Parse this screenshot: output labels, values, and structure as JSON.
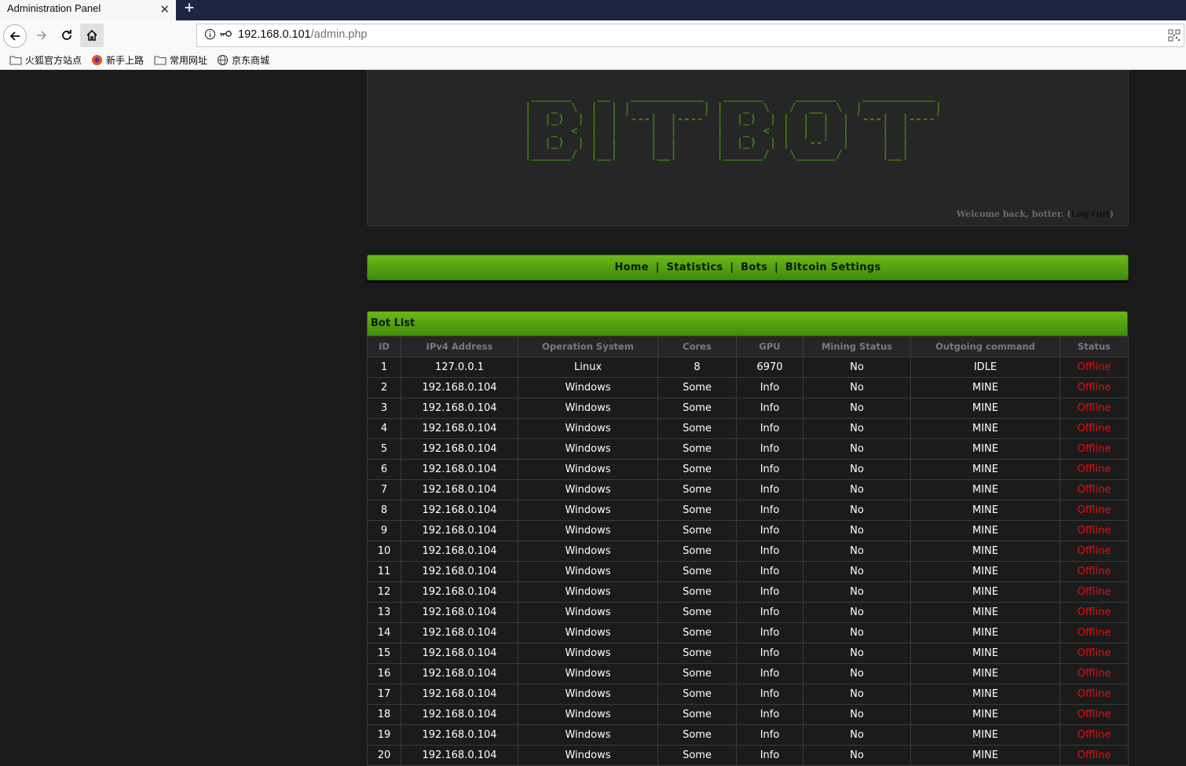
{
  "browser": {
    "tab_title": "Administration Panel",
    "url_host": "192.168.0.101",
    "url_path": "/admin.php",
    "bookmarks": [
      "火狐官方站点",
      "新手上路",
      "常用网址",
      "京东商城"
    ]
  },
  "header": {
    "logo_ascii": " ______    __   ___________   ______     ______    ___________\n|   _  \\  |  | |           | |   _  \\   /  __  \\  |           |\n|  |_)  | |  | `---|  |----` |  |_)  | |  |  |  | `---|  |----`\n|   _  <  |  |     |  |      |   _  <  |  |  |  |     |  |\n|  |_)  | |  |     |  |      |  |_)  | |  `--'  |     |  |\n|______/  |__|     |__|      |______/   \\______/      |__|",
    "welcome_text": "Welcome back, botter. (",
    "logout_label": "Log Out",
    "welcome_close": ")"
  },
  "menu": {
    "home": "Home",
    "statistics": "Statistics",
    "bots": "Bots",
    "bitcoin_settings": "Bitcoin Settings",
    "separator": "|"
  },
  "bot_list": {
    "title": "Bot List",
    "columns": [
      "ID",
      "IPv4 Address",
      "Operation System",
      "Cores",
      "GPU",
      "Mining Status",
      "Outgoing command",
      "Status"
    ],
    "rows": [
      [
        "1",
        "127.0.0.1",
        "Linux",
        "8",
        "6970",
        "No",
        "IDLE",
        "Offline"
      ],
      [
        "2",
        "192.168.0.104",
        "Windows",
        "Some",
        "Info",
        "No",
        "MINE",
        "Offline"
      ],
      [
        "3",
        "192.168.0.104",
        "Windows",
        "Some",
        "Info",
        "No",
        "MINE",
        "Offline"
      ],
      [
        "4",
        "192.168.0.104",
        "Windows",
        "Some",
        "Info",
        "No",
        "MINE",
        "Offline"
      ],
      [
        "5",
        "192.168.0.104",
        "Windows",
        "Some",
        "Info",
        "No",
        "MINE",
        "Offline"
      ],
      [
        "6",
        "192.168.0.104",
        "Windows",
        "Some",
        "Info",
        "No",
        "MINE",
        "Offline"
      ],
      [
        "7",
        "192.168.0.104",
        "Windows",
        "Some",
        "Info",
        "No",
        "MINE",
        "Offline"
      ],
      [
        "8",
        "192.168.0.104",
        "Windows",
        "Some",
        "Info",
        "No",
        "MINE",
        "Offline"
      ],
      [
        "9",
        "192.168.0.104",
        "Windows",
        "Some",
        "Info",
        "No",
        "MINE",
        "Offline"
      ],
      [
        "10",
        "192.168.0.104",
        "Windows",
        "Some",
        "Info",
        "No",
        "MINE",
        "Offline"
      ],
      [
        "11",
        "192.168.0.104",
        "Windows",
        "Some",
        "Info",
        "No",
        "MINE",
        "Offline"
      ],
      [
        "12",
        "192.168.0.104",
        "Windows",
        "Some",
        "Info",
        "No",
        "MINE",
        "Offline"
      ],
      [
        "13",
        "192.168.0.104",
        "Windows",
        "Some",
        "Info",
        "No",
        "MINE",
        "Offline"
      ],
      [
        "14",
        "192.168.0.104",
        "Windows",
        "Some",
        "Info",
        "No",
        "MINE",
        "Offline"
      ],
      [
        "15",
        "192.168.0.104",
        "Windows",
        "Some",
        "Info",
        "No",
        "MINE",
        "Offline"
      ],
      [
        "16",
        "192.168.0.104",
        "Windows",
        "Some",
        "Info",
        "No",
        "MINE",
        "Offline"
      ],
      [
        "17",
        "192.168.0.104",
        "Windows",
        "Some",
        "Info",
        "No",
        "MINE",
        "Offline"
      ],
      [
        "18",
        "192.168.0.104",
        "Windows",
        "Some",
        "Info",
        "No",
        "MINE",
        "Offline"
      ],
      [
        "19",
        "192.168.0.104",
        "Windows",
        "Some",
        "Info",
        "No",
        "MINE",
        "Offline"
      ],
      [
        "20",
        "192.168.0.104",
        "Windows",
        "Some",
        "Info",
        "No",
        "MINE",
        "Offline"
      ]
    ]
  },
  "colors": {
    "page_bg": "#1a1a1a",
    "accent_green": "#5aa313",
    "logo_green": "#3f7f12",
    "offline_red": "#e11010"
  }
}
